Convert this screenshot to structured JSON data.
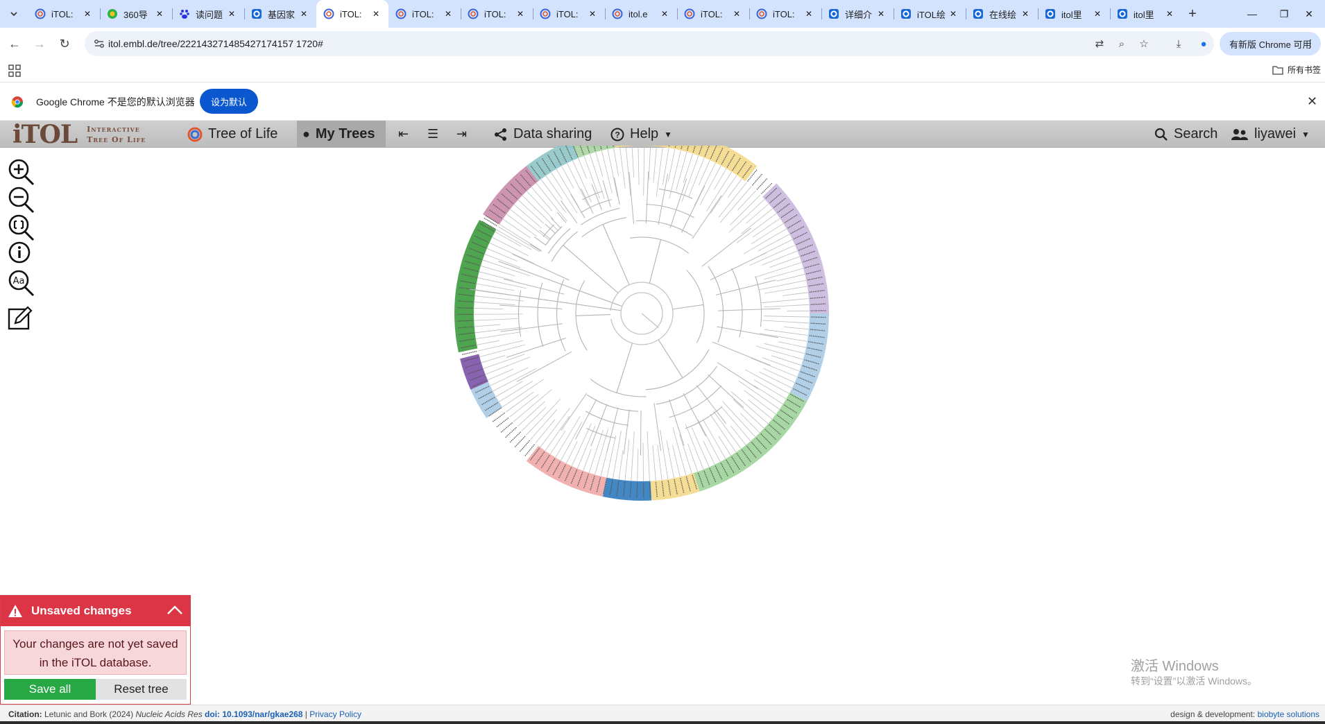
{
  "browser": {
    "tabs": [
      {
        "title": "iTOL:",
        "icon": "itol-icon"
      },
      {
        "title": "360导",
        "icon": "360-icon"
      },
      {
        "title": "读问题",
        "icon": "baidu-icon"
      },
      {
        "title": "基因家",
        "icon": "o-icon"
      },
      {
        "title": "iTOL:",
        "icon": "itol-icon",
        "active": true
      },
      {
        "title": "iTOL:",
        "icon": "itol-icon"
      },
      {
        "title": "iTOL:",
        "icon": "itol-icon"
      },
      {
        "title": "iTOL:",
        "icon": "itol-icon"
      },
      {
        "title": "itol.e",
        "icon": "itol-icon"
      },
      {
        "title": "iTOL:",
        "icon": "itol-icon"
      },
      {
        "title": "iTOL:",
        "icon": "itol-icon"
      },
      {
        "title": "详细介",
        "icon": "o-icon"
      },
      {
        "title": "iTOL绘",
        "icon": "o-icon"
      },
      {
        "title": "在线绘",
        "icon": "o-icon"
      },
      {
        "title": "itol里",
        "icon": "o-icon"
      },
      {
        "title": "itol里",
        "icon": "o-icon"
      }
    ],
    "url": "itol.embl.de/tree/222143271485427174157 1720#",
    "update_label": "有新版 Chrome 可用",
    "bookmarks_label": "所有书签",
    "infobar_text": "Google Chrome 不是您的默认浏览器",
    "infobar_button": "设为默认"
  },
  "itol": {
    "logo_main": "iTOL",
    "logo_line1": "Interactive",
    "logo_line2": "Tree Of Life",
    "nav": {
      "tree_of_life": "Tree of Life",
      "my_trees": "My Trees",
      "data_sharing": "Data sharing",
      "help": "Help",
      "search": "Search",
      "user": "liyawei"
    }
  },
  "unsaved": {
    "title": "Unsaved changes",
    "message_line1": "Your changes are not yet saved",
    "message_line2": "in the iTOL database.",
    "save_label": "Save all",
    "reset_label": "Reset tree"
  },
  "watermark": {
    "line1": "激活 Windows",
    "line2": "转到“设置”以激活 Windows。"
  },
  "footer": {
    "citation_label": "Citation:",
    "citation_text": "Letunic and Bork (2024)",
    "journal": "Nucleic Acids Res",
    "doi": "doi: 10.1093/nar/gkae268",
    "privacy": "Privacy Policy",
    "credit_label": "design & development:",
    "credit_link": "biobyte solutions"
  },
  "tree_colors": {
    "pink": "#c98aa9",
    "teal": "#8ec5c8",
    "green_light": "#a8d5a0",
    "yellow": "#f5d98a",
    "purple_light": "#c9b7dd",
    "blue_light": "#a9cbe6",
    "green_mid": "#9dd49a",
    "blue_dark": "#2f7bbf",
    "salmon": "#f0a9a9",
    "purple_dark": "#7b52a8",
    "green_dark": "#3c9a3c"
  }
}
